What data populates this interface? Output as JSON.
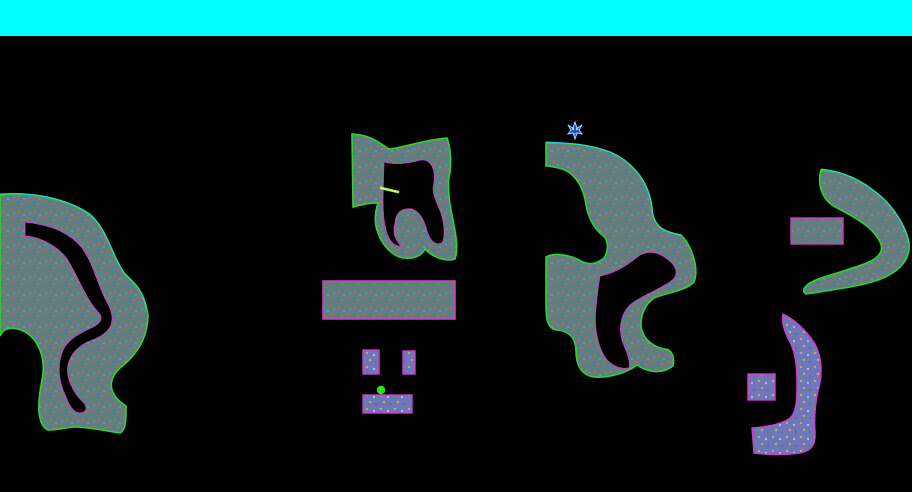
{
  "colors": {
    "top_bar": "#00ffff",
    "background": "#000000",
    "rock_fill": "#5f7f87",
    "rock_speckle": "#c66a2c",
    "rock_edge_primary": "#27d82a",
    "rock_edge_secondary": "#d13acb",
    "rock_edge_tertiary": "#1fd7e6",
    "stone_fill": "#6e78b8",
    "stone_speckle": "#c8a95b",
    "stone_edge": "#d13acb",
    "worm_body": "#244eb8",
    "worm_outline": "#99d3ff",
    "ball": "#22e51f",
    "plank": "#b6ff5e"
  },
  "icons": {
    "worm": "worm-icon",
    "ball": "ball-icon",
    "plank": "plank-icon"
  }
}
